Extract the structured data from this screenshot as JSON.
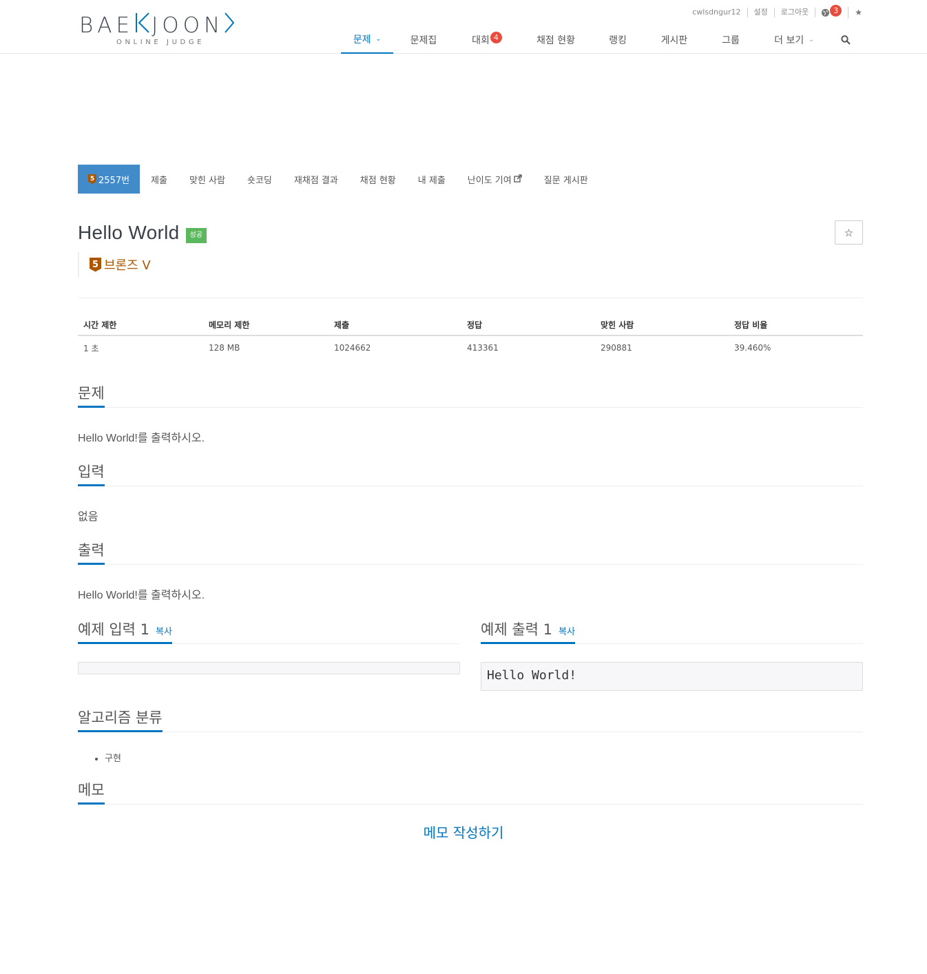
{
  "header": {
    "logo": {
      "text_pre": "BAE",
      "text_k": "K",
      "text_post": "JOON",
      "tagline": "ONLINE JUDGE"
    },
    "user_bar": {
      "username": "cwlsdngur12",
      "settings": "설정",
      "logout": "로그아웃",
      "notifications_count": "3",
      "star": "★"
    },
    "nav": {
      "problems": "문제",
      "workbooks": "문제집",
      "contests": "대회",
      "contests_badge": "4",
      "status": "채점 현황",
      "ranking": "랭킹",
      "board": "게시판",
      "groups": "그룹",
      "more": "더 보기"
    }
  },
  "problem_tabs": {
    "tier_level": "5",
    "number_tab": "2557번",
    "submit": "제출",
    "solved_users": "맞힌 사람",
    "short_coding": "숏코딩",
    "rejudge": "재채점 결과",
    "status": "채점 현황",
    "my_submissions": "내 제출",
    "difficulty_contrib": "난이도 기여",
    "qna_board": "질문 게시판"
  },
  "problem": {
    "title": "Hello World",
    "status_label": "성공",
    "tier_level": "5",
    "tier_name": "브론즈 V",
    "star_button": "☆"
  },
  "info_table": {
    "headers": [
      "시간 제한",
      "메모리 제한",
      "제출",
      "정답",
      "맞힌 사람",
      "정답 비율"
    ],
    "values": [
      "1 초",
      "128 MB",
      "1024662",
      "413361",
      "290881",
      "39.460%"
    ]
  },
  "sections": {
    "description_title": "문제",
    "description_text": "Hello World!를 출력하시오.",
    "input_title": "입력",
    "input_text": "없음",
    "output_title": "출력",
    "output_text": "Hello World!를 출력하시오.",
    "sample_input_title": "예제 입력 1",
    "sample_output_title": "예제 출력 1",
    "copy_label": "복사",
    "sample_input": "",
    "sample_output": "Hello World!",
    "algorithm_title": "알고리즘 분류",
    "algorithms": [
      "구현"
    ],
    "memo_title": "메모",
    "memo_link": "메모 작성하기"
  },
  "colors": {
    "accent": "#0076c0",
    "active_tab": "#428bca",
    "success": "#5cb85c",
    "bronze": "#ad5600",
    "badge_red": "#e74c3c"
  }
}
